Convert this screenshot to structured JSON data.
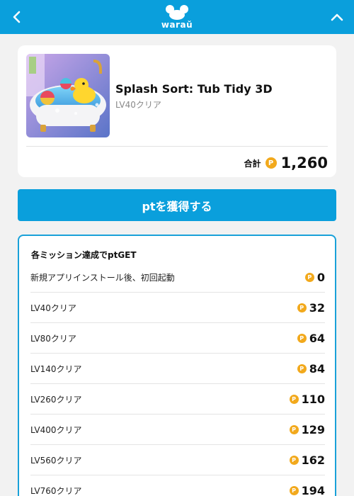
{
  "header": {
    "logo_text": "waraŭ",
    "back_icon": "chevron-left-icon",
    "collapse_icon": "chevron-up-icon",
    "brand_color": "#0a9fdc"
  },
  "app": {
    "title": "Splash Sort: Tub Tidy 3D",
    "subtitle": "LV40クリア"
  },
  "total": {
    "label": "合計",
    "coin_mark": "P",
    "value": "1,260"
  },
  "cta": {
    "label": "ptを獲得する"
  },
  "missions": {
    "heading": "各ミッション達成でptGET",
    "coin_mark": "P",
    "items": [
      {
        "name": "新規アプリインストール後、初回起動",
        "points": "0"
      },
      {
        "name": "LV40クリア",
        "points": "32"
      },
      {
        "name": "LV80クリア",
        "points": "64"
      },
      {
        "name": "LV140クリア",
        "points": "84"
      },
      {
        "name": "LV260クリア",
        "points": "110"
      },
      {
        "name": "LV400クリア",
        "points": "129"
      },
      {
        "name": "LV560クリア",
        "points": "162"
      },
      {
        "name": "LV760クリア",
        "points": "194"
      }
    ]
  },
  "colors": {
    "accent": "#0a9fdc",
    "coin": "#f2a91c",
    "border": "#19a1d9"
  }
}
